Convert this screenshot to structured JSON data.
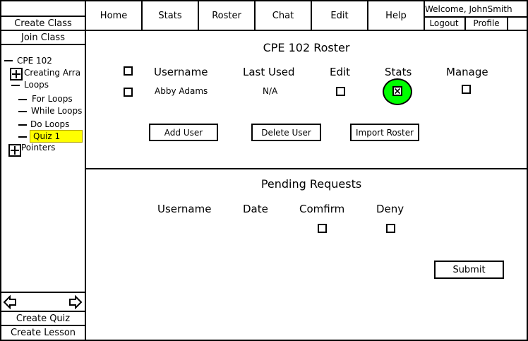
{
  "nav": {
    "tabs": [
      {
        "label": "Home"
      },
      {
        "label": "Stats"
      },
      {
        "label": "Roster"
      },
      {
        "label": "Chat"
      },
      {
        "label": "Edit"
      },
      {
        "label": "Help"
      }
    ],
    "welcome": "Welcome, JohnSmith",
    "logout": "Logout",
    "profile": "Profile"
  },
  "sidebar": {
    "create_class": "Create Class",
    "join_class": "Join Class",
    "tree": {
      "course": "CPE 102",
      "creating_arrays": "Creating Arra",
      "loops": "Loops",
      "for_loops": "For Loops",
      "while_loops": "While Loops",
      "do_loops": "Do Loops",
      "quiz": "Quiz 1",
      "pointers": "Pointers"
    },
    "create_quiz": "Create Quiz",
    "create_lesson": "Create Lesson"
  },
  "roster": {
    "title": "CPE 102 Roster",
    "columns": {
      "username": "Username",
      "last_used": "Last Used",
      "edit": "Edit",
      "stats": "Stats",
      "manage": "Manage"
    },
    "rows": [
      {
        "username": "Abby Adams",
        "last_used": "N/A"
      }
    ],
    "add_user": "Add User",
    "delete_user": "Delete User",
    "import_roster": "Import Roster"
  },
  "pending": {
    "title": "Pending Requests",
    "columns": {
      "username": "Username",
      "date": "Date",
      "confirm": "Comfirm",
      "deny": "Deny"
    },
    "submit": "Submit"
  },
  "colors": {
    "highlight": "#ffff00",
    "stats_circle": "#00ff00"
  }
}
